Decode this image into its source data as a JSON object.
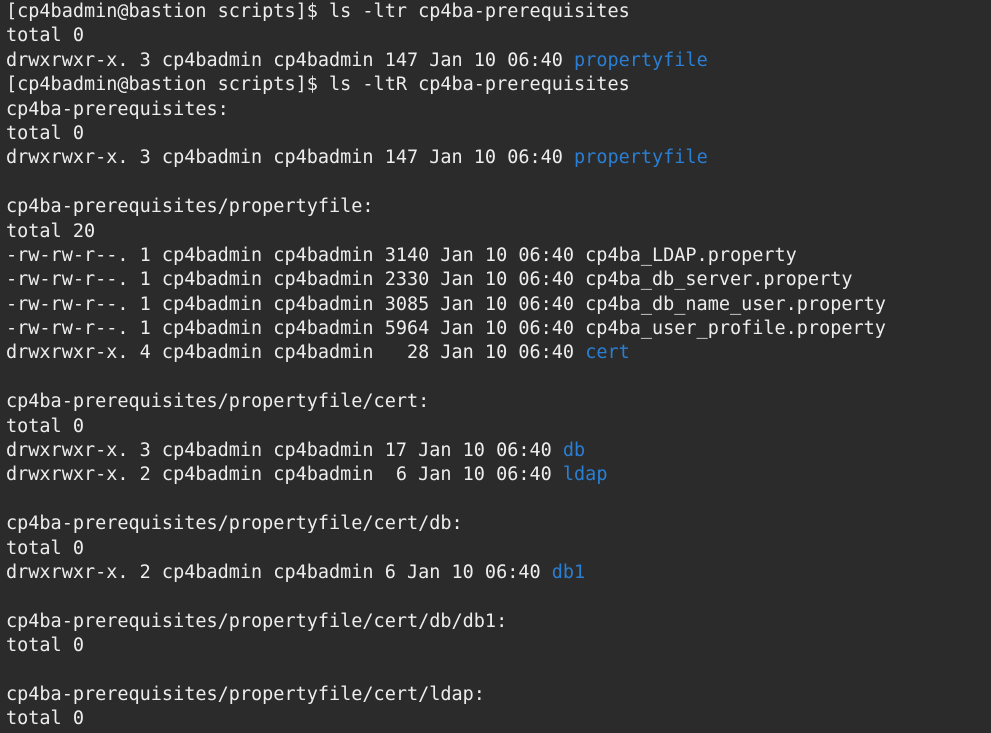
{
  "terminal": {
    "colors": {
      "background": "#2b2b2b",
      "text": "#ededed",
      "directory": "#2a7fd4"
    },
    "lines": [
      [
        {
          "t": "[cp4badmin@bastion scripts]$ ls -ltr cp4ba-prerequisites"
        }
      ],
      [
        {
          "t": "total 0"
        }
      ],
      [
        {
          "t": "drwxrwxr-x. 3 cp4badmin cp4badmin 147 Jan 10 06:40 "
        },
        {
          "t": "propertyfile",
          "k": "dir"
        }
      ],
      [
        {
          "t": "[cp4badmin@bastion scripts]$ ls -ltR cp4ba-prerequisites"
        }
      ],
      [
        {
          "t": "cp4ba-prerequisites:"
        }
      ],
      [
        {
          "t": "total 0"
        }
      ],
      [
        {
          "t": "drwxrwxr-x. 3 cp4badmin cp4badmin 147 Jan 10 06:40 "
        },
        {
          "t": "propertyfile",
          "k": "dir"
        }
      ],
      [],
      [
        {
          "t": "cp4ba-prerequisites/propertyfile:"
        }
      ],
      [
        {
          "t": "total 20"
        }
      ],
      [
        {
          "t": "-rw-rw-r--. 1 cp4badmin cp4badmin 3140 Jan 10 06:40 cp4ba_LDAP.property"
        }
      ],
      [
        {
          "t": "-rw-rw-r--. 1 cp4badmin cp4badmin 2330 Jan 10 06:40 cp4ba_db_server.property"
        }
      ],
      [
        {
          "t": "-rw-rw-r--. 1 cp4badmin cp4badmin 3085 Jan 10 06:40 cp4ba_db_name_user.property"
        }
      ],
      [
        {
          "t": "-rw-rw-r--. 1 cp4badmin cp4badmin 5964 Jan 10 06:40 cp4ba_user_profile.property"
        }
      ],
      [
        {
          "t": "drwxrwxr-x. 4 cp4badmin cp4badmin   28 Jan 10 06:40 "
        },
        {
          "t": "cert",
          "k": "dir"
        }
      ],
      [],
      [
        {
          "t": "cp4ba-prerequisites/propertyfile/cert:"
        }
      ],
      [
        {
          "t": "total 0"
        }
      ],
      [
        {
          "t": "drwxrwxr-x. 3 cp4badmin cp4badmin 17 Jan 10 06:40 "
        },
        {
          "t": "db",
          "k": "dir"
        }
      ],
      [
        {
          "t": "drwxrwxr-x. 2 cp4badmin cp4badmin  6 Jan 10 06:40 "
        },
        {
          "t": "ldap",
          "k": "dir"
        }
      ],
      [],
      [
        {
          "t": "cp4ba-prerequisites/propertyfile/cert/db:"
        }
      ],
      [
        {
          "t": "total 0"
        }
      ],
      [
        {
          "t": "drwxrwxr-x. 2 cp4badmin cp4badmin 6 Jan 10 06:40 "
        },
        {
          "t": "db1",
          "k": "dir"
        }
      ],
      [],
      [
        {
          "t": "cp4ba-prerequisites/propertyfile/cert/db/db1:"
        }
      ],
      [
        {
          "t": "total 0"
        }
      ],
      [],
      [
        {
          "t": "cp4ba-prerequisites/propertyfile/cert/ldap:"
        }
      ],
      [
        {
          "t": "total 0"
        }
      ]
    ]
  }
}
